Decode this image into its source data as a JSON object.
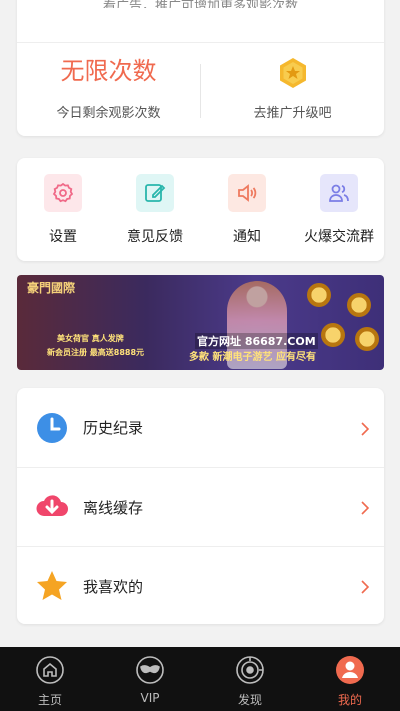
{
  "top_card": {
    "hint": "看广告，推广可增加更多观影次数",
    "remaining_value": "无限次数",
    "remaining_label": "今日剩余观影次数",
    "upgrade_label": "去推广升级吧"
  },
  "grid": [
    {
      "label": "设置",
      "icon": "settings-icon"
    },
    {
      "label": "意见反馈",
      "icon": "feedback-icon"
    },
    {
      "label": "通知",
      "icon": "speaker-icon"
    },
    {
      "label": "火爆交流群",
      "icon": "group-icon"
    }
  ],
  "banner": {
    "logo_text": "豪門國際",
    "line1": "美女荷官 真人发牌",
    "line2": "新会员注册 最高送8888元",
    "url_text": "官方网址 86687.COM",
    "line3": "多款 新潮电子游艺 应有尽有"
  },
  "list": [
    {
      "label": "历史纪录",
      "icon": "clock-icon"
    },
    {
      "label": "离线缓存",
      "icon": "cloud-download-icon"
    },
    {
      "label": "我喜欢的",
      "icon": "star-icon"
    }
  ],
  "nav": [
    {
      "label": "主页",
      "icon": "home-icon"
    },
    {
      "label": "VIP",
      "icon": "mask-icon"
    },
    {
      "label": "发现",
      "icon": "discover-icon"
    },
    {
      "label": "我的",
      "icon": "profile-icon",
      "active": true
    }
  ],
  "colors": {
    "accent": "#f06a4f",
    "nav_bg": "#111111",
    "page_bg": "#f2f2f2"
  }
}
